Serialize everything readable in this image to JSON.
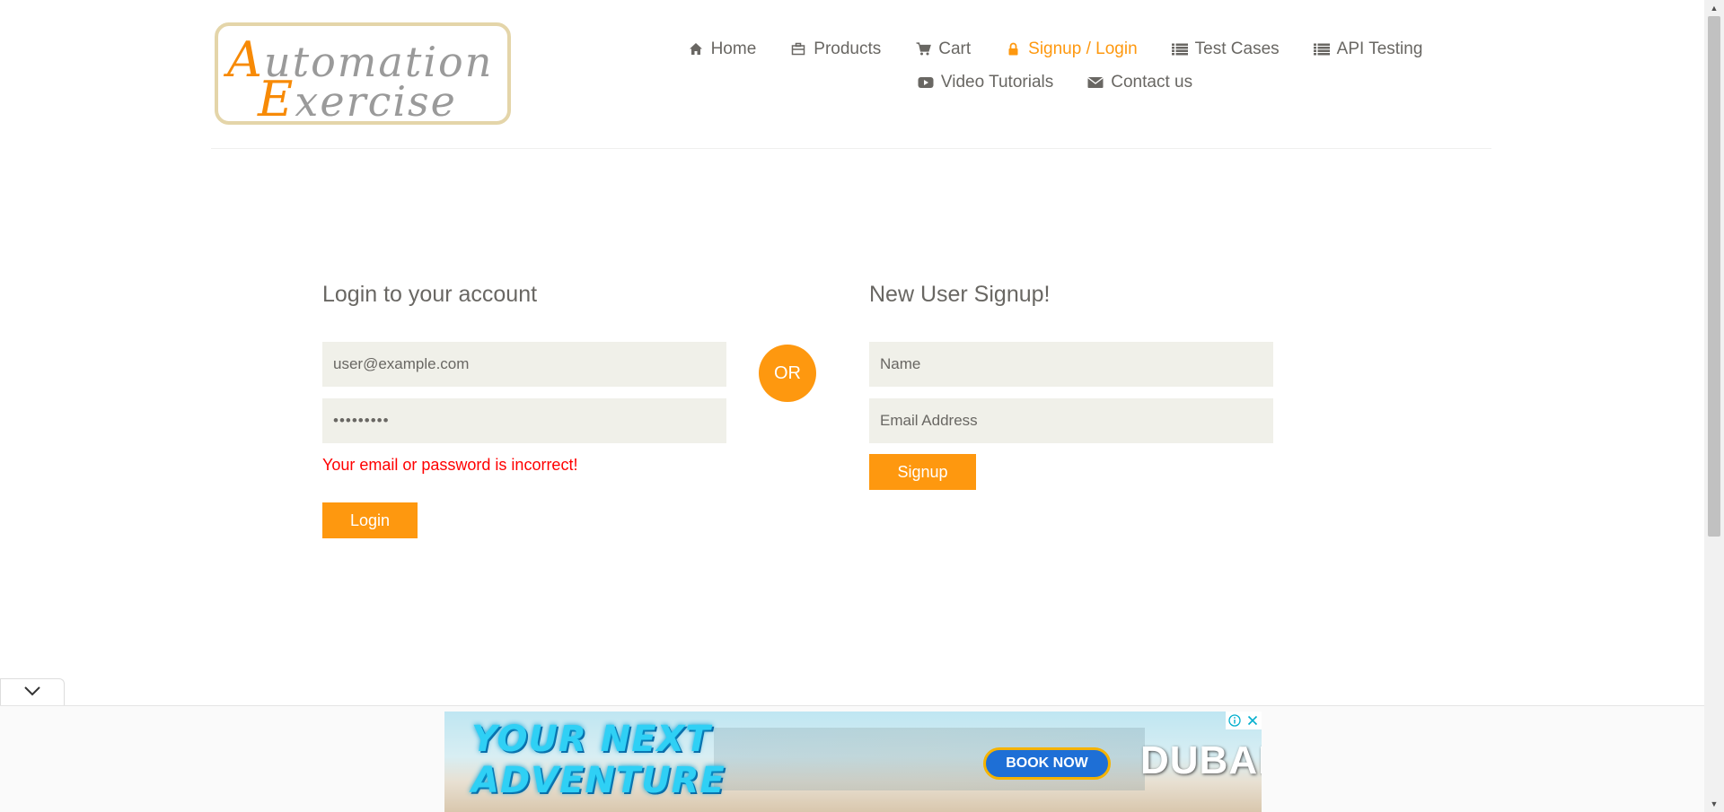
{
  "logo": {
    "line1_cap": "A",
    "line1_rest": "utomation",
    "line2_cap": "E",
    "line2_rest": "xercise"
  },
  "nav": {
    "row1": [
      {
        "label": "Home",
        "icon": "home-icon"
      },
      {
        "label": "Products",
        "icon": "products-icon"
      },
      {
        "label": "Cart",
        "icon": "cart-icon"
      },
      {
        "label": "Signup / Login",
        "icon": "lock-icon",
        "active": true
      },
      {
        "label": "Test Cases",
        "icon": "list-icon"
      },
      {
        "label": "API Testing",
        "icon": "list-icon"
      }
    ],
    "row2": [
      {
        "label": "Video Tutorials",
        "icon": "youtube-icon"
      },
      {
        "label": "Contact us",
        "icon": "envelope-icon"
      }
    ]
  },
  "login": {
    "title": "Login to your account",
    "email_value": "user@example.com",
    "password_value": "•••••••••",
    "error": "Your email or password is incorrect!",
    "button": "Login"
  },
  "or_label": "OR",
  "signup": {
    "title": "New User Signup!",
    "name_placeholder": "Name",
    "email_placeholder": "Email Address",
    "button": "Signup"
  },
  "ad": {
    "headline_line1": "YOUR NEXT",
    "headline_line2": "ADVENTURE",
    "cta": "BOOK NOW",
    "brand": "DUBAI"
  },
  "colors": {
    "accent": "#FE980F",
    "error": "#ff0000",
    "input_bg": "#F0F0E9",
    "text": "#696763"
  }
}
